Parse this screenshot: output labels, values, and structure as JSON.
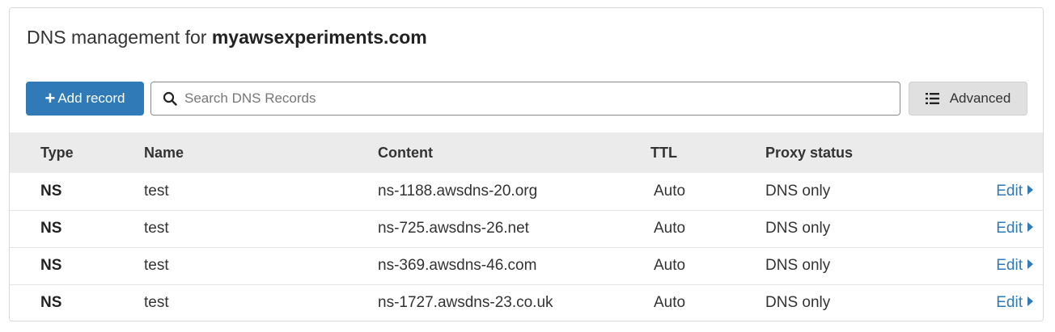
{
  "header": {
    "title_prefix": "DNS management for",
    "domain": "myawsexperiments.com"
  },
  "toolbar": {
    "add_label": "Add record",
    "search_placeholder": "Search DNS Records",
    "search_value": "",
    "advanced_label": "Advanced"
  },
  "table": {
    "columns": [
      "Type",
      "Name",
      "Content",
      "TTL",
      "Proxy status"
    ],
    "rows": [
      {
        "type": "NS",
        "name": "test",
        "content": "ns-1188.awsdns-20.org",
        "ttl": "Auto",
        "proxy": "DNS only",
        "action": "Edit"
      },
      {
        "type": "NS",
        "name": "test",
        "content": "ns-725.awsdns-26.net",
        "ttl": "Auto",
        "proxy": "DNS only",
        "action": "Edit"
      },
      {
        "type": "NS",
        "name": "test",
        "content": "ns-369.awsdns-46.com",
        "ttl": "Auto",
        "proxy": "DNS only",
        "action": "Edit"
      },
      {
        "type": "NS",
        "name": "test",
        "content": "ns-1727.awsdns-23.co.uk",
        "ttl": "Auto",
        "proxy": "DNS only",
        "action": "Edit"
      }
    ]
  },
  "icons": {
    "add": "plus-icon",
    "search": "search-icon",
    "advanced": "list-icon",
    "edit": "caret-right-icon"
  },
  "colors": {
    "primary": "#2f7ab7",
    "header_bg": "#ebebeb",
    "button_gray": "#e0e0e0"
  }
}
